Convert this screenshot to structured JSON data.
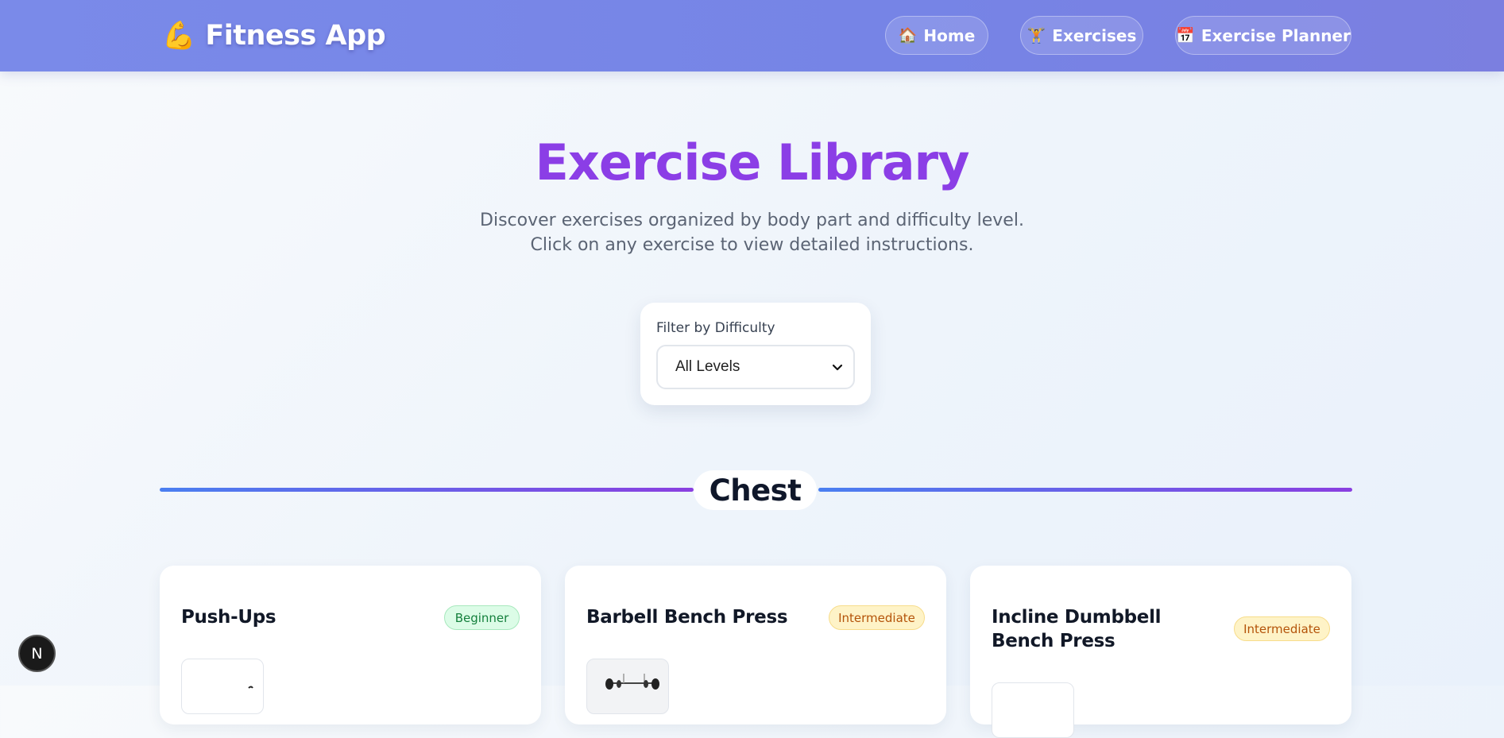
{
  "header": {
    "brand_icon": "💪",
    "brand_name": "Fitness App",
    "nav": [
      {
        "label": "Home",
        "icon": "🏠"
      },
      {
        "label": "Exercises",
        "icon": "🏋"
      },
      {
        "label": "Exercise Planner",
        "icon": "📅"
      }
    ]
  },
  "hero": {
    "title": "Exercise Library",
    "subtitle_line1": "Discover exercises organized by body part and difficulty level.",
    "subtitle_line2": "Click on any exercise to view detailed instructions."
  },
  "filter": {
    "label": "Filter by Difficulty",
    "selected": "All Levels"
  },
  "section": {
    "title": "Chest"
  },
  "exercises": [
    {
      "name": "Push-Ups",
      "difficulty": "Beginner"
    },
    {
      "name": "Barbell Bench Press",
      "difficulty": "Intermediate"
    },
    {
      "name": "Incline Dumbbell Bench Press",
      "difficulty": "Intermediate"
    }
  ],
  "dev_badge": {
    "label": "N"
  },
  "colors": {
    "header_gradient_start": "#7a8ae9",
    "title_purple": "#8b3ee6",
    "beginner_bg": "#dcfce7",
    "beginner_text": "#15803d",
    "intermediate_bg": "#fef3c7",
    "intermediate_text": "#b45309"
  }
}
